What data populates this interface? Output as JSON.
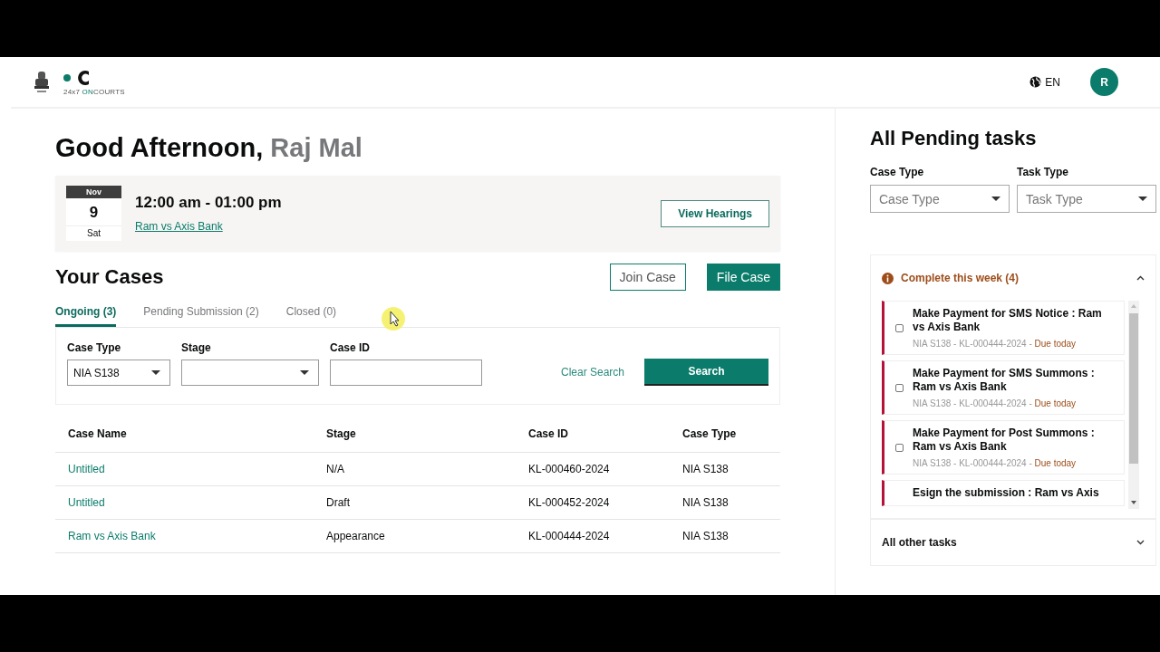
{
  "logo": {
    "prefix": "24x7 ",
    "accent": "ON",
    "suffix": "COURTS"
  },
  "header": {
    "language": "EN",
    "avatar": "R"
  },
  "greeting": {
    "salutation": "Good Afternoon,",
    "name": "Raj Mal"
  },
  "hearing": {
    "month": "Nov",
    "day": "9",
    "weekday": "Sat",
    "time": "12:00 am - 01:00 pm",
    "case_link": "Ram vs Axis Bank",
    "button": "View Hearings"
  },
  "cases": {
    "title": "Your Cases",
    "buttons": [
      {
        "label": "Join Case",
        "kind": "outline"
      },
      {
        "label": "File Case",
        "kind": "primary"
      }
    ],
    "tabs": [
      {
        "label": "Ongoing (3)",
        "selected": true
      },
      {
        "label": "Pending Submission (2)",
        "selected": false
      },
      {
        "label": "Closed (0)",
        "selected": false
      }
    ],
    "filters": [
      {
        "label": "Case Type",
        "kind": "select",
        "value": "NIA S138"
      },
      {
        "label": "Stage",
        "kind": "select"
      },
      {
        "label": "Case ID",
        "kind": "text"
      }
    ],
    "clear_search": "Clear Search",
    "search_button": "Search",
    "table": {
      "columns": [
        "Case Name",
        "Stage",
        "Case ID",
        "Case Type"
      ],
      "rows": [
        [
          "Untitled",
          "N/A",
          "KL-000460-2024",
          "NIA S138"
        ],
        [
          "Untitled",
          "Draft",
          "KL-000452-2024",
          "NIA S138"
        ],
        [
          "Ram vs Axis Bank",
          "Appearance",
          "KL-000444-2024",
          "NIA S138"
        ]
      ]
    }
  },
  "tasks": {
    "title": "All Pending tasks",
    "filters": [
      {
        "label": "Case Type",
        "placeholder": "Case Type"
      },
      {
        "label": "Task Type",
        "placeholder": "Task Type"
      }
    ],
    "sections": [
      {
        "title": "Complete this week (4)",
        "kind": "urgent",
        "expanded": true,
        "items": [
          {
            "title": "Make Payment for SMS Notice : Ram vs Axis Bank",
            "meta": "NIA S138 - KL-000444-2024 - ",
            "due": "Due today",
            "checked": false
          },
          {
            "title": "Make Payment for SMS Summons : Ram vs Axis Bank",
            "meta": "NIA S138 - KL-000444-2024 - ",
            "due": "Due today",
            "checked": false
          },
          {
            "title": "Make Payment for Post Summons : Ram vs Axis Bank",
            "meta": "NIA S138 - KL-000444-2024 - ",
            "due": "Due today",
            "checked": false
          },
          {
            "title": "Esign the submission : Ram vs Axis"
          }
        ]
      },
      {
        "title": "All other tasks",
        "kind": "normal",
        "expanded": false
      }
    ]
  }
}
